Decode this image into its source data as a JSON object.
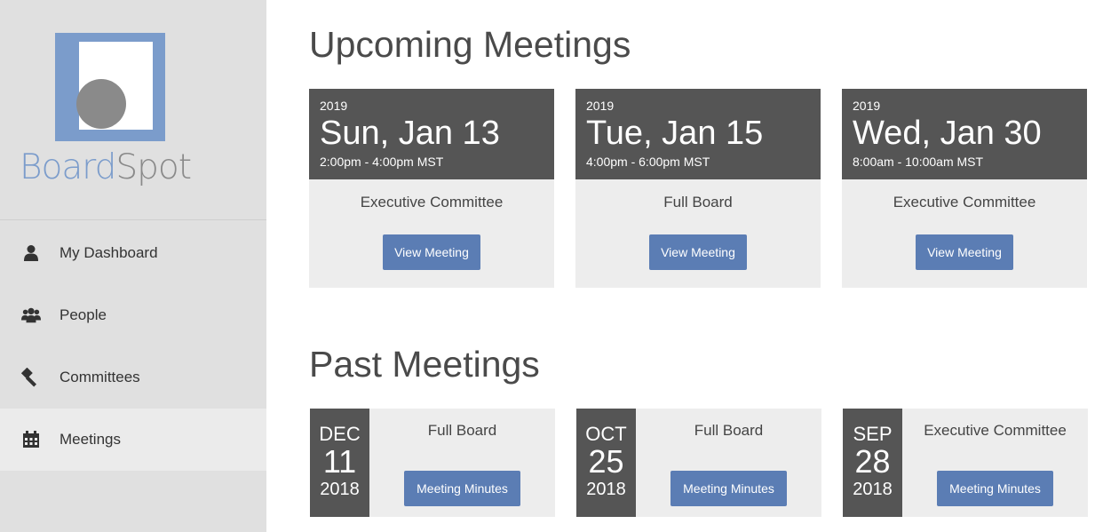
{
  "logo": {
    "part1": "Board",
    "part2": "Spot"
  },
  "nav": [
    {
      "label": "My Dashboard",
      "icon": "user-icon",
      "active": false
    },
    {
      "label": "People",
      "icon": "people-icon",
      "active": false
    },
    {
      "label": "Committees",
      "icon": "gavel-icon",
      "active": false
    },
    {
      "label": "Meetings",
      "icon": "calendar-icon",
      "active": true
    }
  ],
  "upcoming": {
    "title": "Upcoming Meetings",
    "meetings": [
      {
        "year": "2019",
        "date": "Sun, Jan 13",
        "time": "2:00pm - 4:00pm MST",
        "name": "Executive Committee",
        "button": "View Meeting"
      },
      {
        "year": "2019",
        "date": "Tue, Jan 15",
        "time": "4:00pm - 6:00pm MST",
        "name": "Full Board",
        "button": "View Meeting"
      },
      {
        "year": "2019",
        "date": "Wed, Jan 30",
        "time": "8:00am - 10:00am MST",
        "name": "Executive Committee",
        "button": "View Meeting"
      }
    ]
  },
  "past": {
    "title": "Past Meetings",
    "meetings": [
      {
        "month": "DEC",
        "day": "11",
        "year": "2018",
        "name": "Full Board",
        "button": "Meeting Minutes"
      },
      {
        "month": "OCT",
        "day": "25",
        "year": "2018",
        "name": "Full Board",
        "button": "Meeting Minutes"
      },
      {
        "month": "SEP",
        "day": "28",
        "year": "2018",
        "name": "Executive Committee",
        "button": "Meeting Minutes"
      }
    ]
  },
  "colors": {
    "sidebar": "#e0e0e0",
    "accent": "#5b7db4",
    "logo_blue": "#7b9ccb",
    "card_header": "#555555"
  }
}
